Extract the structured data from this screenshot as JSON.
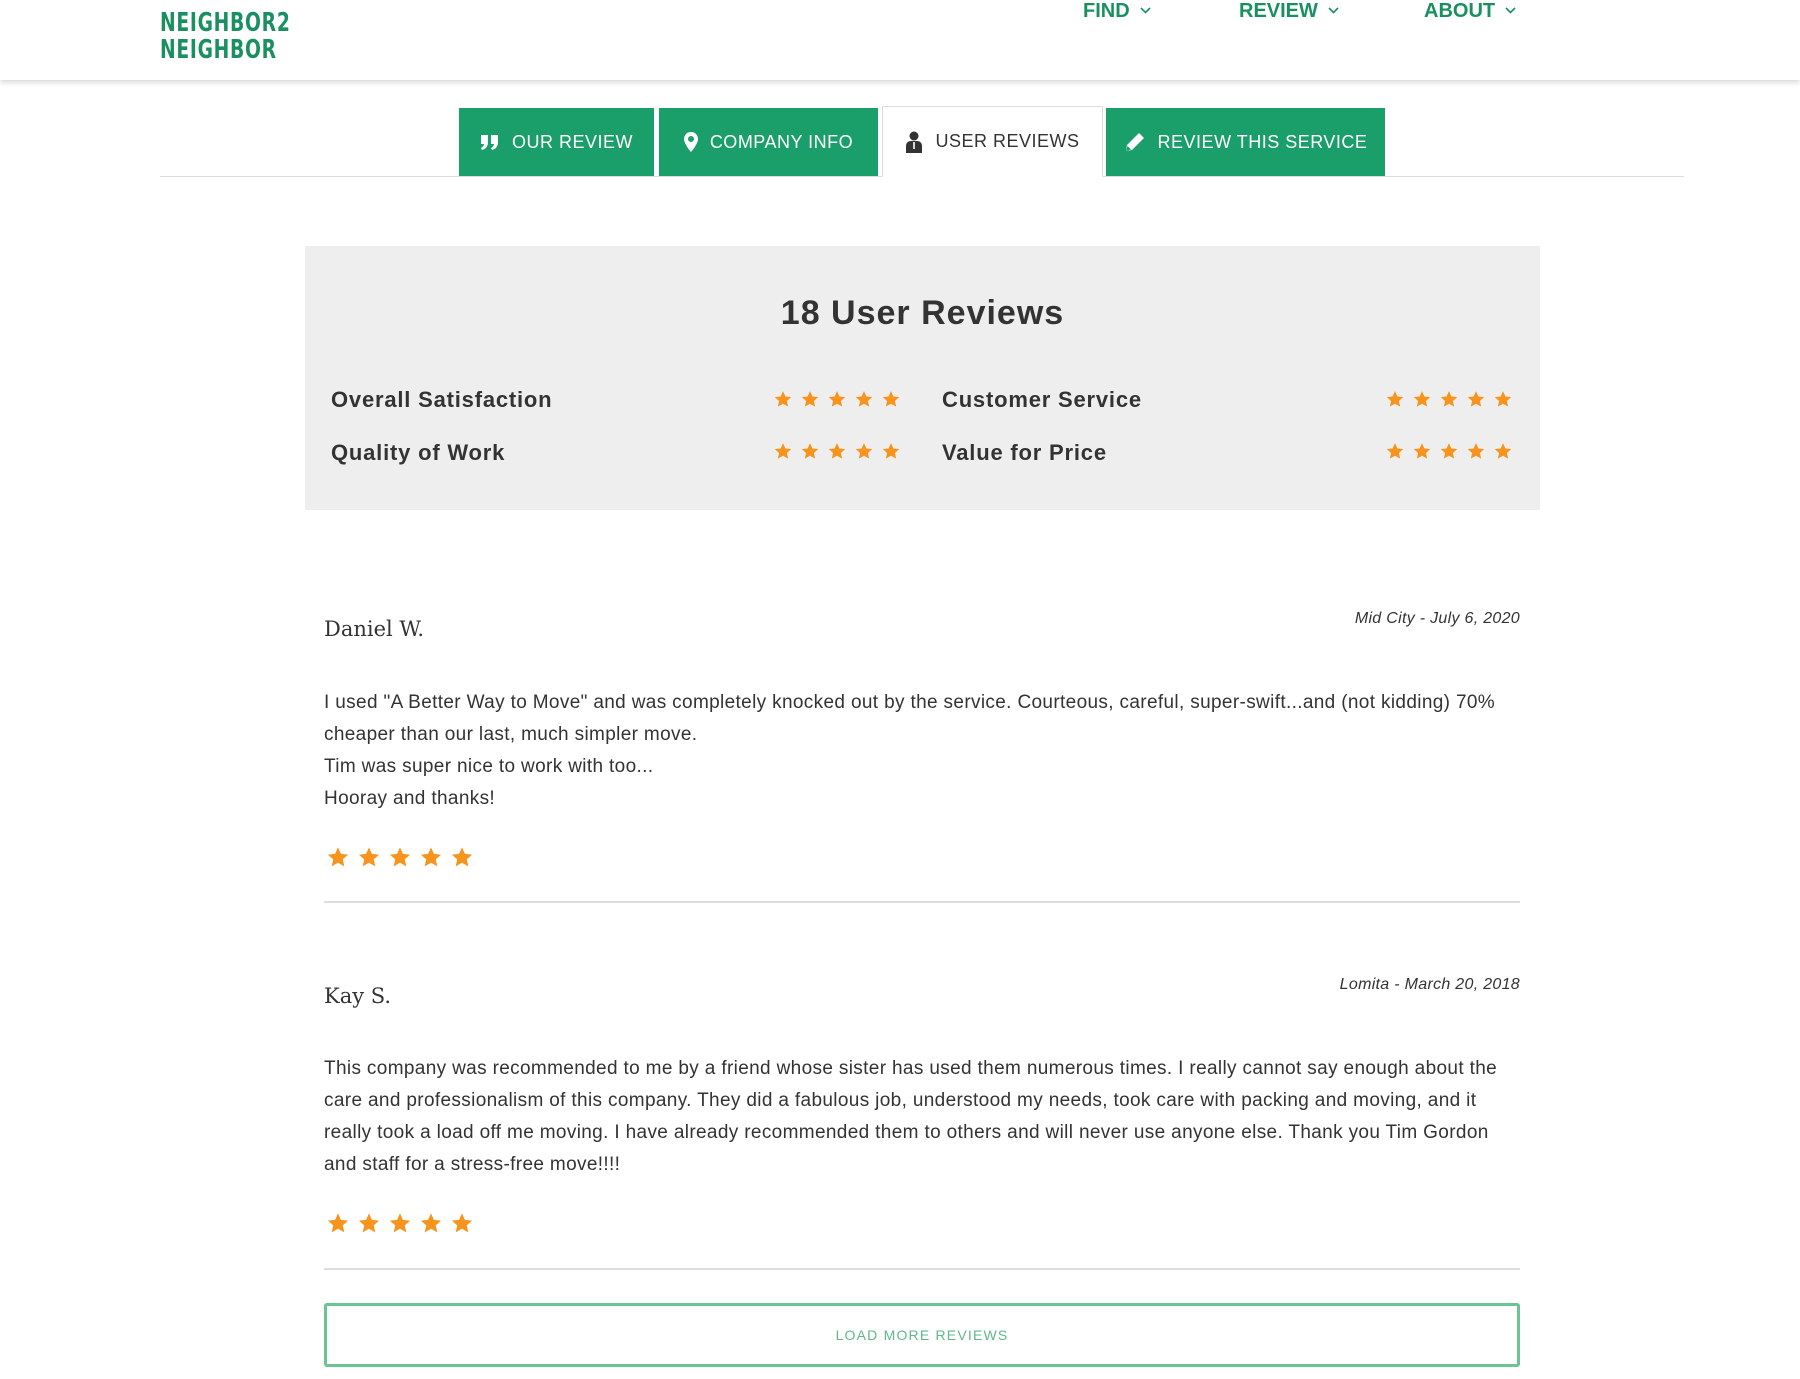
{
  "header": {
    "logo_line1": "NEIGHBOR",
    "logo_line2": "NEIGHBOR",
    "logo_superscript": "2",
    "nav": [
      {
        "label": "FIND",
        "icon": "chevron-down-icon"
      },
      {
        "label": "REVIEW",
        "icon": "chevron-down-icon"
      },
      {
        "label": "ABOUT",
        "icon": "chevron-down-icon"
      }
    ]
  },
  "tabs": [
    {
      "label": "OUR REVIEW",
      "icon": "quote-icon",
      "active": false
    },
    {
      "label": "COMPANY INFO",
      "icon": "map-pin-icon",
      "active": false
    },
    {
      "label": "USER REVIEWS",
      "icon": "user-icon",
      "active": true
    },
    {
      "label": "REVIEW THIS SERVICE",
      "icon": "pencil-icon",
      "active": false
    }
  ],
  "summary": {
    "title": "18 User Reviews",
    "ratings": [
      {
        "label": "Overall Satisfaction",
        "stars": 5
      },
      {
        "label": "Customer Service",
        "stars": 5
      },
      {
        "label": "Quality of Work",
        "stars": 5
      },
      {
        "label": "Value for Price",
        "stars": 5
      }
    ]
  },
  "reviews": [
    {
      "name": "Daniel W.",
      "meta": "Mid City - July 6, 2020",
      "lines": [
        "I used \"A Better Way to Move\" and was completely knocked out by the service. Courteous, careful, super-swift...and (not kidding) 70% cheaper than our last, much simpler move.",
        "Tim was super nice to work with too...",
        "Hooray and thanks!"
      ],
      "stars": 5
    },
    {
      "name": "Kay S.",
      "meta": "Lomita - March 20, 2018",
      "lines": [
        "This company was recommended to me by a friend whose sister has used them numerous times. I really cannot say enough about the care and professionalism of this company. They did a fabulous job, understood my needs, took care with packing and moving, and it really took a load off me moving. I have already recommended them to others and will never use anyone else. Thank you Tim Gordon and staff for a stress-free move!!!!"
      ],
      "stars": 5
    }
  ],
  "load_more_label": "LOAD MORE REVIEWS",
  "colors": {
    "brand_green": "#1a9e6a",
    "star_orange": "#f7941d",
    "summary_bg": "#eeeeee",
    "load_more_border": "#6cc394"
  }
}
